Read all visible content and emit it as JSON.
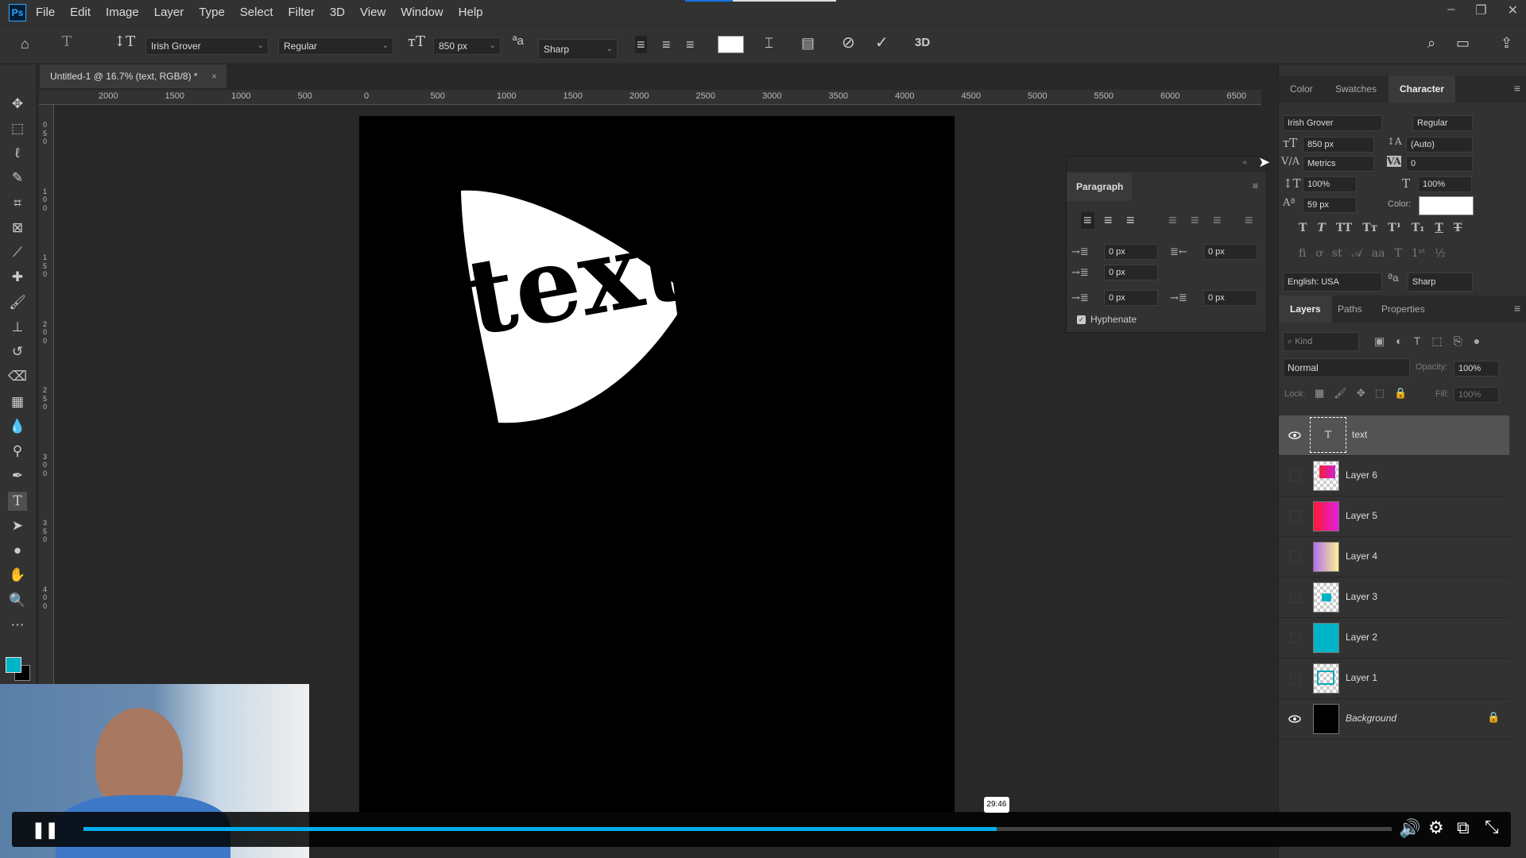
{
  "app": {
    "logo": "Ps",
    "menu": [
      "File",
      "Edit",
      "Image",
      "Layer",
      "Type",
      "Select",
      "Filter",
      "3D",
      "View",
      "Window",
      "Help"
    ]
  },
  "options": {
    "font": "Irish Grover",
    "style": "Regular",
    "size": "850 px",
    "antialias": "Sharp",
    "color": "#ffffff"
  },
  "document": {
    "tab_title": "Untitled-1 @ 16.7% (text, RGB/8) *",
    "close": "×",
    "canvas_text": "text"
  },
  "ruler": {
    "top": [
      "2000",
      "1500",
      "1000",
      "500",
      "0",
      "500",
      "1000",
      "1500",
      "2000",
      "2500",
      "3000",
      "3500",
      "4000",
      "4500",
      "5000",
      "5500",
      "6000",
      "6500"
    ],
    "left": [
      "0",
      "5",
      "0",
      "1",
      "0",
      "0",
      "1",
      "5",
      "0",
      "2",
      "0",
      "0",
      "2",
      "5",
      "0",
      "3",
      "0",
      "0",
      "3",
      "5",
      "0",
      "4",
      "0",
      "0"
    ]
  },
  "character": {
    "tabs": [
      "Color",
      "Swatches",
      "Character"
    ],
    "font": "Irish Grover",
    "style": "Regular",
    "size": "850 px",
    "leading": "(Auto)",
    "kerning": "Metrics",
    "tracking": "0",
    "vscale": "100%",
    "hscale": "100%",
    "baseline": "59 px",
    "color_label": "Color:",
    "color": "#ffffff",
    "language": "English: USA",
    "antialias": "Sharp"
  },
  "paragraph": {
    "title": "Paragraph",
    "indent_left": "0 px",
    "indent_right": "0 px",
    "indent_first": "0 px",
    "space_before": "0 px",
    "space_after": "0 px",
    "hyphenate": "Hyphenate",
    "hyphenate_checked": true
  },
  "layers": {
    "tabs": [
      "Layers",
      "Paths",
      "Properties"
    ],
    "filter": "Kind",
    "blend": "Normal",
    "opacity_label": "Opacity:",
    "opacity": "100%",
    "lock_label": "Lock:",
    "fill_label": "Fill:",
    "fill": "100%",
    "items": [
      {
        "name": "text",
        "visible": true,
        "selected": true
      },
      {
        "name": "Layer 6",
        "visible": false
      },
      {
        "name": "Layer 5",
        "visible": false
      },
      {
        "name": "Layer 4",
        "visible": false
      },
      {
        "name": "Layer 3",
        "visible": false
      },
      {
        "name": "Layer 2",
        "visible": false
      },
      {
        "name": "Layer 1",
        "visible": false
      },
      {
        "name": "Background",
        "visible": true,
        "locked": true
      }
    ]
  },
  "player": {
    "time_tooltip": "29:46",
    "progress": 0.698,
    "accent": "#00adef"
  }
}
